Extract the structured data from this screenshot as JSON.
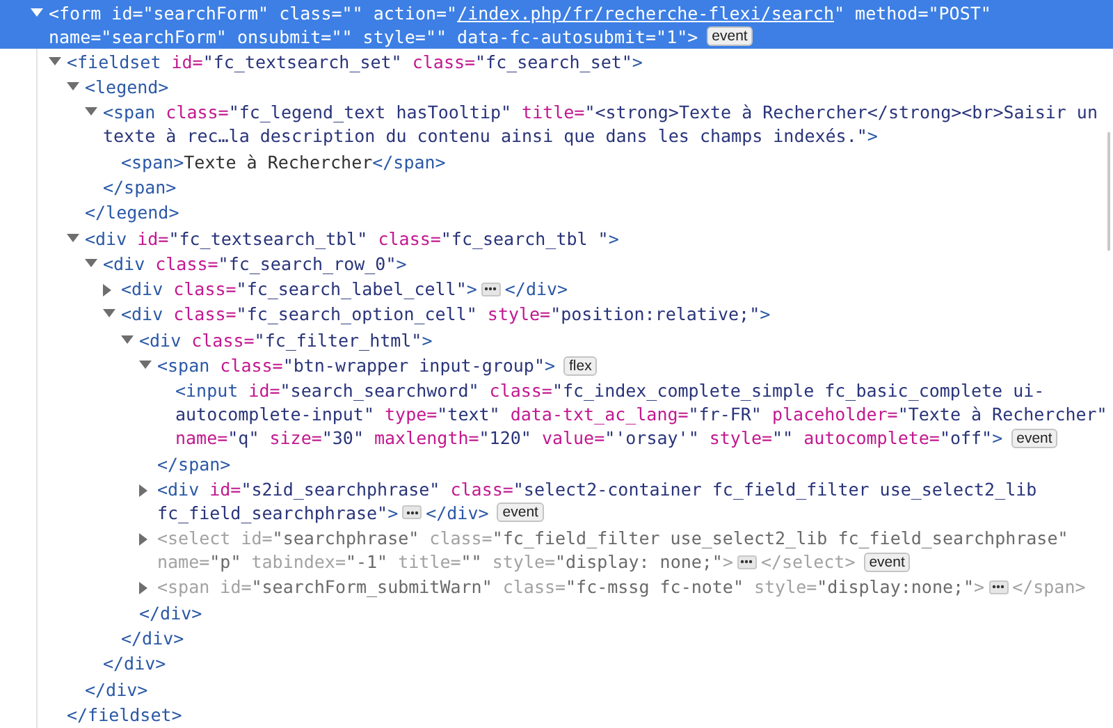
{
  "nodes": [
    {
      "kind": "open",
      "selected": true,
      "dimmed": false,
      "lines": [
        [
          {
            "kind": "code",
            "tokens": [
              {
                "kind": "tag",
                "text": "<form"
              },
              {
                "kind": "attr",
                "text": " id="
              },
              {
                "kind": "val",
                "text": "\"searchForm\""
              },
              {
                "kind": "attr",
                "text": " class="
              },
              {
                "kind": "val",
                "text": "\"\""
              },
              {
                "kind": "attr",
                "text": " action="
              },
              {
                "kind": "val",
                "text": "\""
              },
              {
                "kind": "link",
                "text": "/index.php/fr/recherche-flexi/search"
              },
              {
                "kind": "val",
                "text": "\""
              },
              {
                "kind": "attr",
                "text": " method="
              },
              {
                "kind": "val",
                "text": "\"POST\""
              }
            ]
          }
        ],
        [
          {
            "kind": "code",
            "tokens": [
              {
                "kind": "attr",
                "text": "name="
              },
              {
                "kind": "val",
                "text": "\"searchForm\""
              },
              {
                "kind": "attr",
                "text": " onsubmit="
              },
              {
                "kind": "val",
                "text": "\"\""
              },
              {
                "kind": "attr",
                "text": " style="
              },
              {
                "kind": "val",
                "text": "\"\""
              },
              {
                "kind": "attr",
                "text": " data-fc-autosubmit="
              },
              {
                "kind": "val",
                "text": "\"1\""
              },
              {
                "kind": "tag",
                "text": ">"
              }
            ]
          },
          {
            "kind": "badge",
            "label": "event"
          }
        ]
      ],
      "children": [
        {
          "kind": "open",
          "selected": false,
          "dimmed": false,
          "lines": [
            [
              {
                "kind": "code",
                "tokens": [
                  {
                    "kind": "tag",
                    "text": "<fieldset"
                  },
                  {
                    "kind": "attr",
                    "text": " id="
                  },
                  {
                    "kind": "val",
                    "text": "\"fc_textsearch_set\""
                  },
                  {
                    "kind": "attr",
                    "text": " class="
                  },
                  {
                    "kind": "val",
                    "text": "\"fc_search_set\""
                  },
                  {
                    "kind": "tag",
                    "text": ">"
                  }
                ]
              }
            ]
          ],
          "close": [
            {
              "kind": "tag",
              "text": "</fieldset>"
            }
          ],
          "children": [
            {
              "kind": "open",
              "selected": false,
              "dimmed": false,
              "lines": [
                [
                  {
                    "kind": "code",
                    "tokens": [
                      {
                        "kind": "tag",
                        "text": "<legend>"
                      }
                    ]
                  }
                ]
              ],
              "close": [
                {
                  "kind": "tag",
                  "text": "</legend>"
                }
              ],
              "children": [
                {
                  "kind": "open",
                  "selected": false,
                  "dimmed": false,
                  "lines": [
                    [
                      {
                        "kind": "code",
                        "tokens": [
                          {
                            "kind": "tag",
                            "text": "<span"
                          },
                          {
                            "kind": "attr",
                            "text": " class="
                          },
                          {
                            "kind": "val",
                            "text": "\"fc_legend_text hasTooltip\""
                          },
                          {
                            "kind": "attr",
                            "text": " title="
                          },
                          {
                            "kind": "val",
                            "text": "\"<strong>Texte à Rechercher</strong><br>Saisir un"
                          }
                        ]
                      }
                    ],
                    [
                      {
                        "kind": "code",
                        "tokens": [
                          {
                            "kind": "val",
                            "text": "texte à rec…la description du contenu ainsi que dans les champs indexés.\""
                          },
                          {
                            "kind": "tag",
                            "text": ">"
                          }
                        ]
                      }
                    ]
                  ],
                  "close": [
                    {
                      "kind": "tag",
                      "text": "</span>"
                    }
                  ],
                  "children": [
                    {
                      "kind": "leaf",
                      "selected": false,
                      "dimmed": false,
                      "lines": [
                        [
                          {
                            "kind": "code",
                            "tokens": [
                              {
                                "kind": "tag",
                                "text": "<span>"
                              },
                              {
                                "kind": "text",
                                "text": "Texte à Rechercher"
                              },
                              {
                                "kind": "tag",
                                "text": "</span>"
                              }
                            ]
                          }
                        ]
                      ]
                    }
                  ]
                }
              ]
            },
            {
              "kind": "open",
              "selected": false,
              "dimmed": false,
              "lines": [
                [
                  {
                    "kind": "code",
                    "tokens": [
                      {
                        "kind": "tag",
                        "text": "<div"
                      },
                      {
                        "kind": "attr",
                        "text": " id="
                      },
                      {
                        "kind": "val",
                        "text": "\"fc_textsearch_tbl\""
                      },
                      {
                        "kind": "attr",
                        "text": " class="
                      },
                      {
                        "kind": "val",
                        "text": "\"fc_search_tbl \""
                      },
                      {
                        "kind": "tag",
                        "text": ">"
                      }
                    ]
                  }
                ]
              ],
              "close": [
                {
                  "kind": "tag",
                  "text": "</div>"
                }
              ],
              "children": [
                {
                  "kind": "open",
                  "selected": false,
                  "dimmed": false,
                  "lines": [
                    [
                      {
                        "kind": "code",
                        "tokens": [
                          {
                            "kind": "tag",
                            "text": "<div"
                          },
                          {
                            "kind": "attr",
                            "text": " class="
                          },
                          {
                            "kind": "val",
                            "text": "\"fc_search_row_0\""
                          },
                          {
                            "kind": "tag",
                            "text": ">"
                          }
                        ]
                      }
                    ]
                  ],
                  "close": [
                    {
                      "kind": "tag",
                      "text": "</div>"
                    }
                  ],
                  "children": [
                    {
                      "kind": "closed",
                      "selected": false,
                      "dimmed": false,
                      "lines": [
                        [
                          {
                            "kind": "code",
                            "tokens": [
                              {
                                "kind": "tag",
                                "text": "<div"
                              },
                              {
                                "kind": "attr",
                                "text": " class="
                              },
                              {
                                "kind": "val",
                                "text": "\"fc_search_label_cell\""
                              },
                              {
                                "kind": "tag",
                                "text": ">"
                              }
                            ]
                          },
                          {
                            "kind": "ellipsis"
                          },
                          {
                            "kind": "code",
                            "tokens": [
                              {
                                "kind": "tag",
                                "text": "</div>"
                              }
                            ]
                          }
                        ]
                      ]
                    },
                    {
                      "kind": "open",
                      "selected": false,
                      "dimmed": false,
                      "lines": [
                        [
                          {
                            "kind": "code",
                            "tokens": [
                              {
                                "kind": "tag",
                                "text": "<div"
                              },
                              {
                                "kind": "attr",
                                "text": " class="
                              },
                              {
                                "kind": "val",
                                "text": "\"fc_search_option_cell\""
                              },
                              {
                                "kind": "attr",
                                "text": " style="
                              },
                              {
                                "kind": "val",
                                "text": "\"position:relative;\""
                              },
                              {
                                "kind": "tag",
                                "text": ">"
                              }
                            ]
                          }
                        ]
                      ],
                      "close": [
                        {
                          "kind": "tag",
                          "text": "</div>"
                        }
                      ],
                      "children": [
                        {
                          "kind": "open",
                          "selected": false,
                          "dimmed": false,
                          "lines": [
                            [
                              {
                                "kind": "code",
                                "tokens": [
                                  {
                                    "kind": "tag",
                                    "text": "<div"
                                  },
                                  {
                                    "kind": "attr",
                                    "text": " class="
                                  },
                                  {
                                    "kind": "val",
                                    "text": "\"fc_filter_html\""
                                  },
                                  {
                                    "kind": "tag",
                                    "text": ">"
                                  }
                                ]
                              }
                            ]
                          ],
                          "close": [
                            {
                              "kind": "tag",
                              "text": "</div>"
                            }
                          ],
                          "children": [
                            {
                              "kind": "open",
                              "selected": false,
                              "dimmed": false,
                              "lines": [
                                [
                                  {
                                    "kind": "code",
                                    "tokens": [
                                      {
                                        "kind": "tag",
                                        "text": "<span"
                                      },
                                      {
                                        "kind": "attr",
                                        "text": " class="
                                      },
                                      {
                                        "kind": "val",
                                        "text": "\"btn-wrapper input-group\""
                                      },
                                      {
                                        "kind": "tag",
                                        "text": ">"
                                      }
                                    ]
                                  },
                                  {
                                    "kind": "badge",
                                    "label": "flex"
                                  }
                                ]
                              ],
                              "close": [
                                {
                                  "kind": "tag",
                                  "text": "</span>"
                                }
                              ],
                              "children": [
                                {
                                  "kind": "leaf",
                                  "selected": false,
                                  "dimmed": false,
                                  "lines": [
                                    [
                                      {
                                        "kind": "code",
                                        "tokens": [
                                          {
                                            "kind": "tag",
                                            "text": "<input"
                                          },
                                          {
                                            "kind": "attr",
                                            "text": " id="
                                          },
                                          {
                                            "kind": "val",
                                            "text": "\"search_searchword\""
                                          },
                                          {
                                            "kind": "attr",
                                            "text": " class="
                                          },
                                          {
                                            "kind": "val",
                                            "text": "\"fc_index_complete_simple fc_basic_complete ui-"
                                          }
                                        ]
                                      }
                                    ],
                                    [
                                      {
                                        "kind": "code",
                                        "tokens": [
                                          {
                                            "kind": "val",
                                            "text": "autocomplete-input\""
                                          },
                                          {
                                            "kind": "attr",
                                            "text": " type="
                                          },
                                          {
                                            "kind": "val",
                                            "text": "\"text\""
                                          },
                                          {
                                            "kind": "attr",
                                            "text": " data-txt_ac_lang="
                                          },
                                          {
                                            "kind": "val",
                                            "text": "\"fr-FR\""
                                          },
                                          {
                                            "kind": "attr",
                                            "text": " placeholder="
                                          },
                                          {
                                            "kind": "val",
                                            "text": "\"Texte à Rechercher\""
                                          }
                                        ]
                                      }
                                    ],
                                    [
                                      {
                                        "kind": "code",
                                        "tokens": [
                                          {
                                            "kind": "attr",
                                            "text": "name="
                                          },
                                          {
                                            "kind": "val",
                                            "text": "\"q\""
                                          },
                                          {
                                            "kind": "attr",
                                            "text": " size="
                                          },
                                          {
                                            "kind": "val",
                                            "text": "\"30\""
                                          },
                                          {
                                            "kind": "attr",
                                            "text": " maxlength="
                                          },
                                          {
                                            "kind": "val",
                                            "text": "\"120\""
                                          },
                                          {
                                            "kind": "attr",
                                            "text": " value="
                                          },
                                          {
                                            "kind": "val",
                                            "text": "\"'orsay'\""
                                          },
                                          {
                                            "kind": "attr",
                                            "text": " style="
                                          },
                                          {
                                            "kind": "val",
                                            "text": "\"\""
                                          },
                                          {
                                            "kind": "attr",
                                            "text": " autocomplete="
                                          },
                                          {
                                            "kind": "val",
                                            "text": "\"off\""
                                          },
                                          {
                                            "kind": "tag",
                                            "text": ">"
                                          }
                                        ]
                                      },
                                      {
                                        "kind": "badge",
                                        "label": "event"
                                      }
                                    ]
                                  ]
                                }
                              ]
                            },
                            {
                              "kind": "closed",
                              "selected": false,
                              "dimmed": false,
                              "lines": [
                                [
                                  {
                                    "kind": "code",
                                    "tokens": [
                                      {
                                        "kind": "tag",
                                        "text": "<div"
                                      },
                                      {
                                        "kind": "attr",
                                        "text": " id="
                                      },
                                      {
                                        "kind": "val",
                                        "text": "\"s2id_searchphrase\""
                                      },
                                      {
                                        "kind": "attr",
                                        "text": " class="
                                      },
                                      {
                                        "kind": "val",
                                        "text": "\"select2-container fc_field_filter use_select2_lib"
                                      }
                                    ]
                                  }
                                ],
                                [
                                  {
                                    "kind": "code",
                                    "tokens": [
                                      {
                                        "kind": "val",
                                        "text": "fc_field_searchphrase\""
                                      },
                                      {
                                        "kind": "tag",
                                        "text": ">"
                                      }
                                    ]
                                  },
                                  {
                                    "kind": "ellipsis"
                                  },
                                  {
                                    "kind": "code",
                                    "tokens": [
                                      {
                                        "kind": "tag",
                                        "text": "</div>"
                                      }
                                    ]
                                  },
                                  {
                                    "kind": "badge",
                                    "label": "event"
                                  }
                                ]
                              ]
                            },
                            {
                              "kind": "closed",
                              "selected": false,
                              "dimmed": true,
                              "lines": [
                                [
                                  {
                                    "kind": "code",
                                    "tokens": [
                                      {
                                        "kind": "tag",
                                        "text": "<select"
                                      },
                                      {
                                        "kind": "attr",
                                        "text": " id="
                                      },
                                      {
                                        "kind": "val",
                                        "text": "\"searchphrase\""
                                      },
                                      {
                                        "kind": "attr",
                                        "text": " class="
                                      },
                                      {
                                        "kind": "val",
                                        "text": "\"fc_field_filter use_select2_lib fc_field_searchphrase\""
                                      }
                                    ]
                                  }
                                ],
                                [
                                  {
                                    "kind": "code",
                                    "tokens": [
                                      {
                                        "kind": "attr",
                                        "text": "name="
                                      },
                                      {
                                        "kind": "val",
                                        "text": "\"p\""
                                      },
                                      {
                                        "kind": "attr",
                                        "text": " tabindex="
                                      },
                                      {
                                        "kind": "val",
                                        "text": "\"-1\""
                                      },
                                      {
                                        "kind": "attr",
                                        "text": " title="
                                      },
                                      {
                                        "kind": "val",
                                        "text": "\"\""
                                      },
                                      {
                                        "kind": "attr",
                                        "text": " style="
                                      },
                                      {
                                        "kind": "val",
                                        "text": "\"display: none;\""
                                      },
                                      {
                                        "kind": "tag",
                                        "text": ">"
                                      }
                                    ]
                                  },
                                  {
                                    "kind": "ellipsis"
                                  },
                                  {
                                    "kind": "code",
                                    "tokens": [
                                      {
                                        "kind": "tag",
                                        "text": "</select>"
                                      }
                                    ]
                                  },
                                  {
                                    "kind": "badge",
                                    "label": "event"
                                  }
                                ]
                              ]
                            },
                            {
                              "kind": "closed",
                              "selected": false,
                              "dimmed": true,
                              "lines": [
                                [
                                  {
                                    "kind": "code",
                                    "tokens": [
                                      {
                                        "kind": "tag",
                                        "text": "<span"
                                      },
                                      {
                                        "kind": "attr",
                                        "text": " id="
                                      },
                                      {
                                        "kind": "val",
                                        "text": "\"searchForm_submitWarn\""
                                      },
                                      {
                                        "kind": "attr",
                                        "text": " class="
                                      },
                                      {
                                        "kind": "val",
                                        "text": "\"fc-mssg fc-note\""
                                      },
                                      {
                                        "kind": "attr",
                                        "text": " style="
                                      },
                                      {
                                        "kind": "val",
                                        "text": "\"display:none;\""
                                      },
                                      {
                                        "kind": "tag",
                                        "text": ">"
                                      }
                                    ]
                                  },
                                  {
                                    "kind": "ellipsis"
                                  },
                                  {
                                    "kind": "code",
                                    "tokens": [
                                      {
                                        "kind": "tag",
                                        "text": "</span>"
                                      }
                                    ]
                                  }
                                ]
                              ]
                            }
                          ]
                        }
                      ]
                    }
                  ]
                }
              ]
            }
          ]
        }
      ]
    }
  ]
}
